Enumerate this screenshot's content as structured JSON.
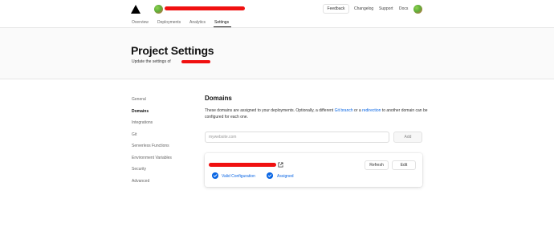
{
  "nav": {
    "project_name_redacted": "",
    "feedback_label": "Feedback",
    "links": [
      "Changelog",
      "Support",
      "Docs"
    ]
  },
  "tabs": [
    {
      "label": "Overview"
    },
    {
      "label": "Deployments"
    },
    {
      "label": "Analytics"
    },
    {
      "label": "Settings",
      "active": true
    }
  ],
  "header": {
    "title": "Project Settings",
    "subtitle": "Update the settings of"
  },
  "sidebar": {
    "items": [
      {
        "label": "General"
      },
      {
        "label": "Domains",
        "active": true
      },
      {
        "label": "Integrations"
      },
      {
        "label": "Git"
      },
      {
        "label": "Serverless Functions"
      },
      {
        "label": "Environment Variables"
      },
      {
        "label": "Security"
      },
      {
        "label": "Advanced"
      }
    ]
  },
  "domains": {
    "title": "Domains",
    "description_part1": "These domains are assigned to your deployments. Optionally, a different ",
    "git_branch_link": "Git branch",
    "description_part2": " or a ",
    "redirection_link": "redirection",
    "description_part3": " to another domain can be configured for each one.",
    "input_placeholder": "mywebsite.com",
    "add_label": "Add",
    "card": {
      "refresh_label": "Refresh",
      "edit_label": "Edit",
      "status_config": "Valid Configuration",
      "status_assigned": "Assigned"
    }
  },
  "colors": {
    "accent": "#0a66e4",
    "redaction": "#f01010",
    "header_bg": "#fafafa"
  },
  "icons": [
    "vercel-logo-icon",
    "avatar-icon",
    "external-link-icon",
    "checkmark-icon"
  ]
}
